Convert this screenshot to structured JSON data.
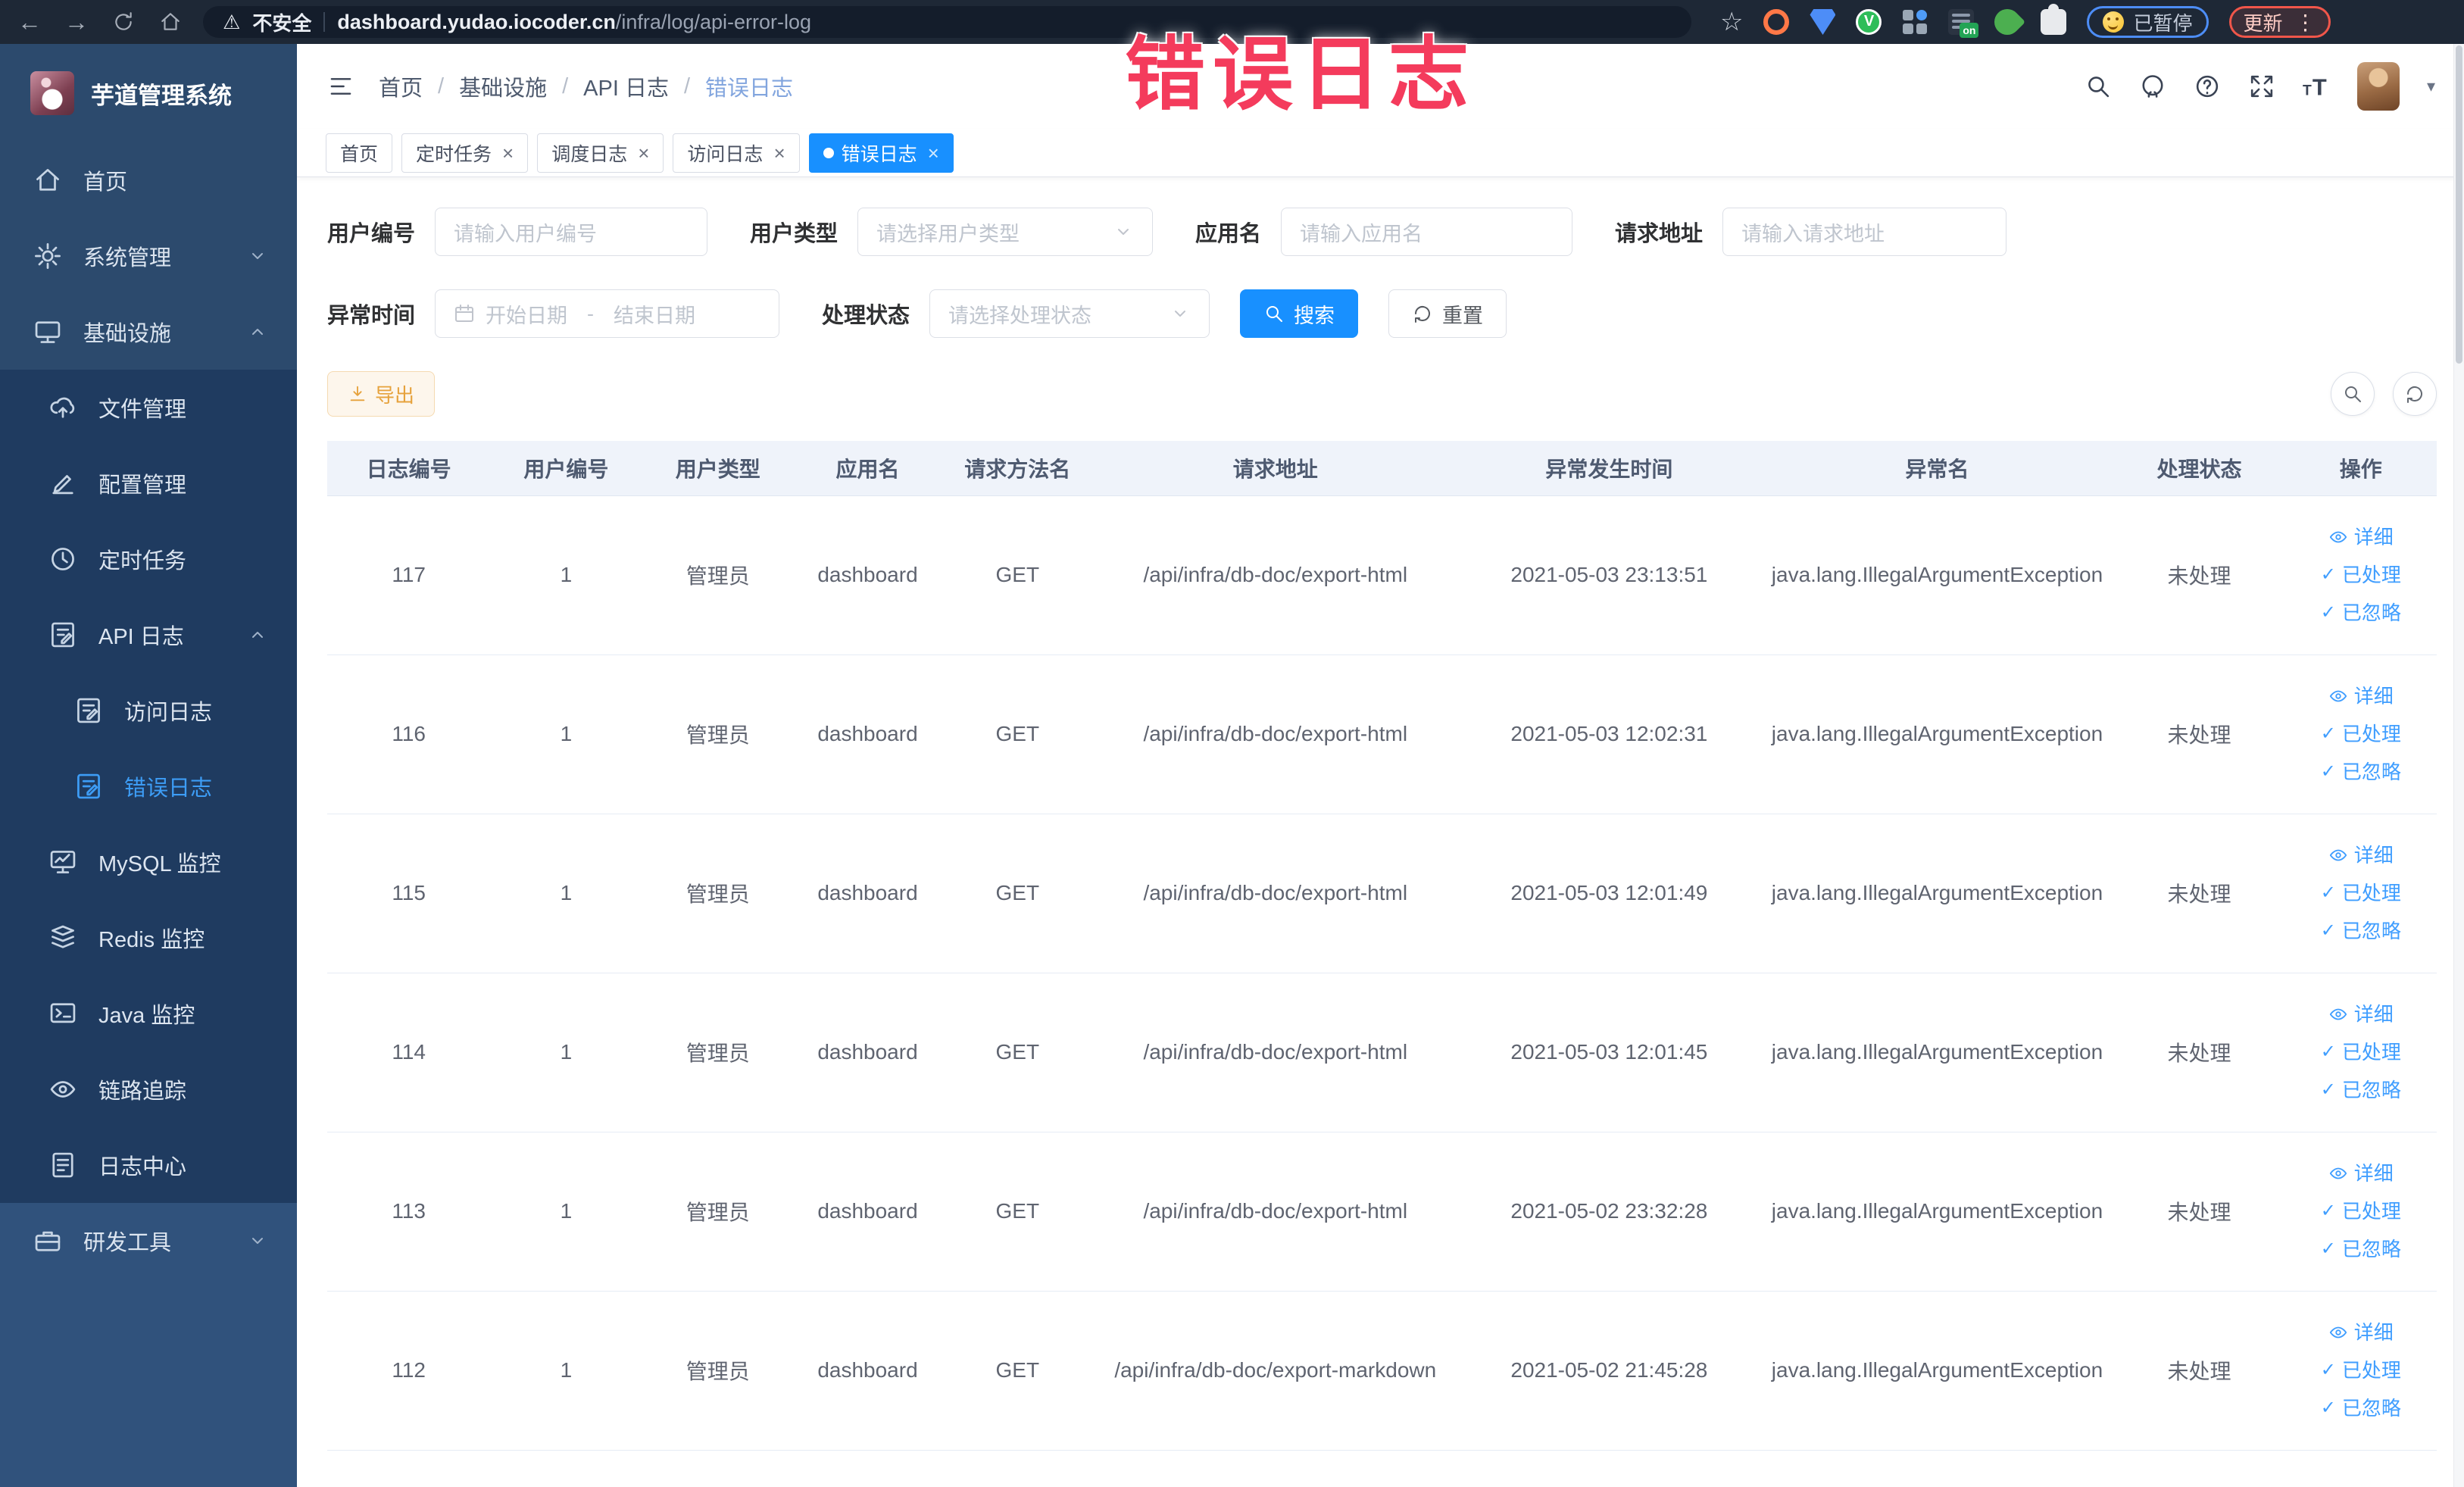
{
  "browser": {
    "security_label": "不安全",
    "url_host": "dashboard.yudao.iocoder.cn",
    "url_path": "/infra/log/api-error-log",
    "paused_badge_label": "已暂停",
    "update_button_label": "更新",
    "extension_on_badge": "on"
  },
  "annotation": {
    "text": "错误日志",
    "color": "#f43b5c"
  },
  "colors": {
    "accent": "#1890ff",
    "link": "#409eff",
    "active_menu": "#3d9df6",
    "warning_button": "#e6a23c"
  },
  "sidebar": {
    "title": "芋道管理系统",
    "menu": [
      {
        "label": "首页",
        "icon": "home-icon",
        "level": 0
      },
      {
        "label": "系统管理",
        "icon": "gear-icon",
        "level": 0,
        "chevron": "down"
      },
      {
        "label": "基础设施",
        "icon": "monitor-icon",
        "level": 0,
        "chevron": "up"
      },
      {
        "label": "文件管理",
        "icon": "cloud-upload-icon",
        "level": 1,
        "sub": true
      },
      {
        "label": "配置管理",
        "icon": "edit-icon",
        "level": 1,
        "sub": true
      },
      {
        "label": "定时任务",
        "icon": "clock-icon",
        "level": 1,
        "sub": true
      },
      {
        "label": "API 日志",
        "icon": "document-edit-icon",
        "level": 1,
        "sub": true,
        "chevron": "up"
      },
      {
        "label": "访问日志",
        "icon": "document-edit-icon",
        "level": 2,
        "sub": true
      },
      {
        "label": "错误日志",
        "icon": "document-edit-icon",
        "level": 2,
        "sub": true,
        "active": true
      },
      {
        "label": "MySQL 监控",
        "icon": "mysql-monitor-icon",
        "level": 1,
        "sub": true
      },
      {
        "label": "Redis 监控",
        "icon": "redis-icon",
        "level": 1,
        "sub": true
      },
      {
        "label": "Java 监控",
        "icon": "java-monitor-icon",
        "level": 1,
        "sub": true
      },
      {
        "label": "链路追踪",
        "icon": "trace-eye-icon",
        "level": 1,
        "sub": true
      },
      {
        "label": "日志中心",
        "icon": "log-center-icon",
        "level": 1,
        "sub": true
      },
      {
        "label": "研发工具",
        "icon": "tools-icon",
        "level": 0,
        "chevron": "down",
        "light": true
      }
    ]
  },
  "header": {
    "breadcrumb": [
      "首页",
      "基础设施",
      "API 日志",
      "错误日志"
    ]
  },
  "tags_bar": {
    "tags": [
      {
        "label": "首页",
        "closable": false,
        "active": false
      },
      {
        "label": "定时任务",
        "closable": true,
        "active": false
      },
      {
        "label": "调度日志",
        "closable": true,
        "active": false
      },
      {
        "label": "访问日志",
        "closable": true,
        "active": false
      },
      {
        "label": "错误日志",
        "closable": true,
        "active": true
      }
    ]
  },
  "filters": {
    "user_id": {
      "label": "用户编号",
      "placeholder": "请输入用户编号"
    },
    "user_type": {
      "label": "用户类型",
      "placeholder": "请选择用户类型"
    },
    "app_name": {
      "label": "应用名",
      "placeholder": "请输入应用名"
    },
    "request_url": {
      "label": "请求地址",
      "placeholder": "请输入请求地址"
    },
    "exception_time": {
      "label": "异常时间",
      "start_placeholder": "开始日期",
      "separator": "-",
      "end_placeholder": "结束日期"
    },
    "process_status": {
      "label": "处理状态",
      "placeholder": "请选择处理状态"
    },
    "search_button": "搜索",
    "reset_button": "重置"
  },
  "actions_bar": {
    "export_button": "导出"
  },
  "table": {
    "headers": [
      "日志编号",
      "用户编号",
      "用户类型",
      "应用名",
      "请求方法名",
      "请求地址",
      "异常发生时间",
      "异常名",
      "处理状态",
      "操作"
    ],
    "row_actions": [
      "详细",
      "已处理",
      "已忽略"
    ],
    "rows": [
      {
        "log_id": "117",
        "user_id": "1",
        "user_type": "管理员",
        "app_name": "dashboard",
        "method": "GET",
        "request_url": "/api/infra/db-doc/export-html",
        "time": "2021-05-03 23:13:51",
        "exception": "java.lang.IllegalArgumentException",
        "status": "未处理"
      },
      {
        "log_id": "116",
        "user_id": "1",
        "user_type": "管理员",
        "app_name": "dashboard",
        "method": "GET",
        "request_url": "/api/infra/db-doc/export-html",
        "time": "2021-05-03 12:02:31",
        "exception": "java.lang.IllegalArgumentException",
        "status": "未处理"
      },
      {
        "log_id": "115",
        "user_id": "1",
        "user_type": "管理员",
        "app_name": "dashboard",
        "method": "GET",
        "request_url": "/api/infra/db-doc/export-html",
        "time": "2021-05-03 12:01:49",
        "exception": "java.lang.IllegalArgumentException",
        "status": "未处理"
      },
      {
        "log_id": "114",
        "user_id": "1",
        "user_type": "管理员",
        "app_name": "dashboard",
        "method": "GET",
        "request_url": "/api/infra/db-doc/export-html",
        "time": "2021-05-03 12:01:45",
        "exception": "java.lang.IllegalArgumentException",
        "status": "未处理"
      },
      {
        "log_id": "113",
        "user_id": "1",
        "user_type": "管理员",
        "app_name": "dashboard",
        "method": "GET",
        "request_url": "/api/infra/db-doc/export-html",
        "time": "2021-05-02 23:32:28",
        "exception": "java.lang.IllegalArgumentException",
        "status": "未处理"
      },
      {
        "log_id": "112",
        "user_id": "1",
        "user_type": "管理员",
        "app_name": "dashboard",
        "method": "GET",
        "request_url": "/api/infra/db-doc/export-markdown",
        "time": "2021-05-02 21:45:28",
        "exception": "java.lang.IllegalArgumentException",
        "status": "未处理"
      }
    ]
  }
}
